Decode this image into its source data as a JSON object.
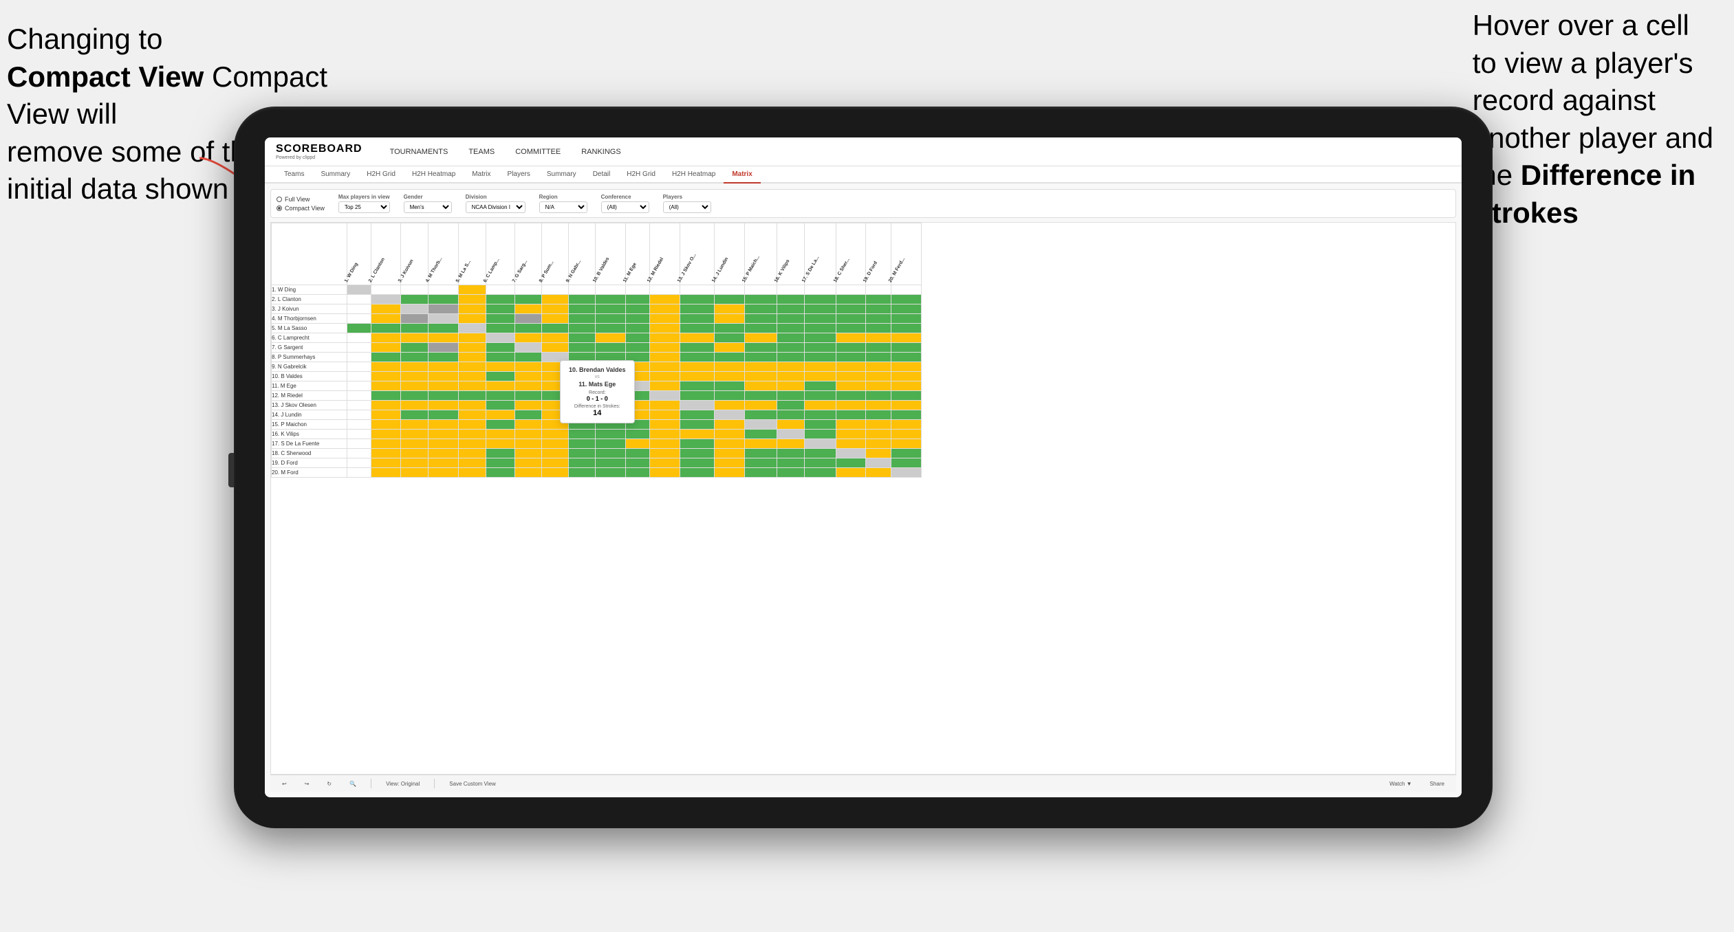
{
  "annotations": {
    "left_text_line1": "Changing to",
    "left_text_line2": "Compact View will",
    "left_text_line3": "remove some of the",
    "left_text_line4": "initial data shown",
    "right_text_line1": "Hover over a cell",
    "right_text_line2": "to view a player's",
    "right_text_line3": "record against",
    "right_text_line4": "another player and",
    "right_text_line5": "the ",
    "right_text_line5b": "Difference in",
    "right_text_line6": "Strokes"
  },
  "app": {
    "logo": "SCOREBOARD",
    "logo_sub": "Powered by clippd",
    "nav_items": [
      "TOURNAMENTS",
      "TEAMS",
      "COMMITTEE",
      "RANKINGS"
    ]
  },
  "sub_nav": {
    "tabs": [
      "Teams",
      "Summary",
      "H2H Grid",
      "H2H Heatmap",
      "Matrix",
      "Players",
      "Summary",
      "Detail",
      "H2H Grid",
      "H2H Heatmap",
      "Matrix"
    ],
    "active_tab": "Matrix"
  },
  "controls": {
    "view_full": "Full View",
    "view_compact": "Compact View",
    "max_players_label": "Max players in view",
    "max_players_value": "Top 25",
    "gender_label": "Gender",
    "gender_value": "Men's",
    "division_label": "Division",
    "division_value": "NCAA Division I",
    "region_label": "Region",
    "region_value": "N/A",
    "conference_label": "Conference",
    "conference_value": "(All)",
    "players_label": "Players",
    "players_value": "(All)"
  },
  "players": [
    "1. W Ding",
    "2. L Clanton",
    "3. J Koivun",
    "4. M Thorbjornsen",
    "5. M La Sasso",
    "6. C Lamprecht",
    "7. G Sargent",
    "8. P Summerhays",
    "9. N Gabrelcik",
    "10. B Valdes",
    "11. M Ege",
    "12. M Riedel",
    "13. J Skov Olesen",
    "14. J Lundin",
    "15. P Maichon",
    "16. K Vilips",
    "17. S De La Fuente",
    "18. C Sherwood",
    "19. D Ford",
    "20. M Ford"
  ],
  "col_headers": [
    "1. W Ding",
    "2. L Clanton",
    "3. J Koivun",
    "4. M Thorbjornsen",
    "5. M La Sasso",
    "6. C Lamprecht",
    "7. G Sargent",
    "8. P Summerhays",
    "9. N Gabrelcik",
    "10. B Valdes",
    "11. M Ege",
    "12. M Riedel",
    "13. J Skov Olesen",
    "14. J Lundin",
    "15. P Maichon",
    "16. K Vilips",
    "17. S De La Fuente",
    "18. C Sherwood",
    "19. D Ford",
    "20. M Ferd"
  ],
  "tooltip": {
    "player1": "10. Brendan Valdes",
    "vs": "vs",
    "player2": "11. Mats Ege",
    "record_label": "Record:",
    "record": "0 - 1 - 0",
    "diff_label": "Difference in Strokes:",
    "diff": "14"
  },
  "toolbar": {
    "undo": "↩",
    "redo": "↪",
    "view_original": "View: Original",
    "save_custom": "Save Custom View",
    "watch": "Watch ▼",
    "share": "Share"
  },
  "colors": {
    "green": "#4caf50",
    "yellow": "#ffc107",
    "gray": "#9e9e9e",
    "white": "#ffffff",
    "red_accent": "#c0392b"
  }
}
